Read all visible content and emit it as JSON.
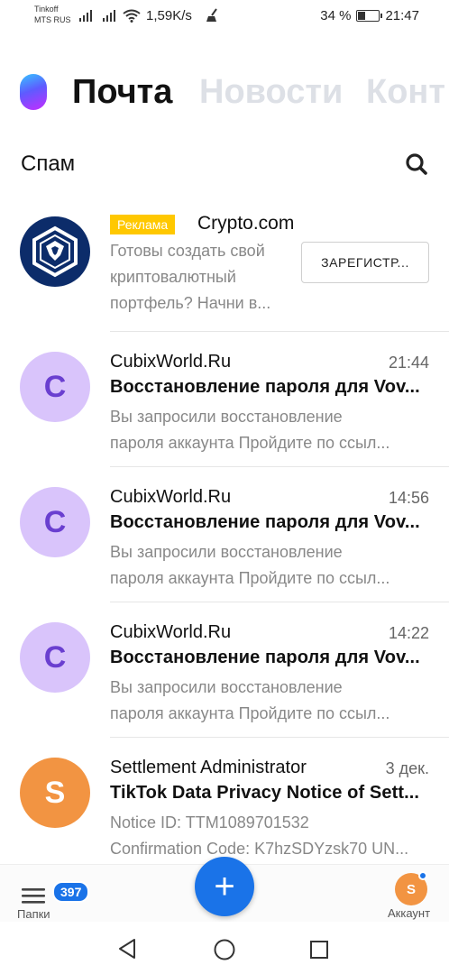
{
  "status_bar": {
    "carrier_line1": "Tinkoff",
    "carrier_line2": "MTS RUS",
    "net_speed": "1,59K/s",
    "battery_percent": "34 %",
    "battery_level": 0.34,
    "time": "21:47"
  },
  "tabs": [
    {
      "label": "Почта",
      "active": true
    },
    {
      "label": "Новости",
      "active": false
    },
    {
      "label": "Конт",
      "active": false
    }
  ],
  "folder": {
    "title": "Спам"
  },
  "ad": {
    "badge": "Реклама",
    "sender": "Crypto.com",
    "text_line1": "Готовы создать свой",
    "text_line2": "криптовалютный",
    "text_line3": "портфель? Начни в...",
    "button_label": "ЗАРЕГИСТР..."
  },
  "emails": [
    {
      "avatar_letter": "C",
      "sender": "CubixWorld.Ru",
      "time": "21:44",
      "subject": "Восстановление пароля для Vov...",
      "snippet_line1": "Вы запросили восстановление",
      "snippet_line2": "пароля аккаунта Пройдите по ссыл..."
    },
    {
      "avatar_letter": "C",
      "sender": "CubixWorld.Ru",
      "time": "14:56",
      "subject": "Восстановление пароля для Vov...",
      "snippet_line1": "Вы запросили восстановление",
      "snippet_line2": "пароля аккаунта Пройдите по ссыл..."
    },
    {
      "avatar_letter": "C",
      "sender": "CubixWorld.Ru",
      "time": "14:22",
      "subject": "Восстановление пароля для Vov...",
      "snippet_line1": "Вы запросили восстановление",
      "snippet_line2": "пароля аккаунта Пройдите по ссыл..."
    },
    {
      "avatar_letter": "S",
      "sender": "Settlement Administrator",
      "time": "3 дек.",
      "subject": "TikTok Data Privacy Notice of Sett...",
      "snippet_line1": "Notice ID: TTM1089701532",
      "snippet_line2": "Confirmation Code: K7hzSDYzsk70 UN..."
    }
  ],
  "bottom_bar": {
    "folders_label": "Папки",
    "unread_count": "397",
    "compose_icon": "+",
    "account_letter": "S",
    "account_label": "Аккаунт"
  },
  "colors": {
    "accent": "#1a73e8",
    "ad_badge": "#ffc800",
    "avatar_c_bg": "#d9c4fb",
    "avatar_s_bg": "#f29442"
  }
}
